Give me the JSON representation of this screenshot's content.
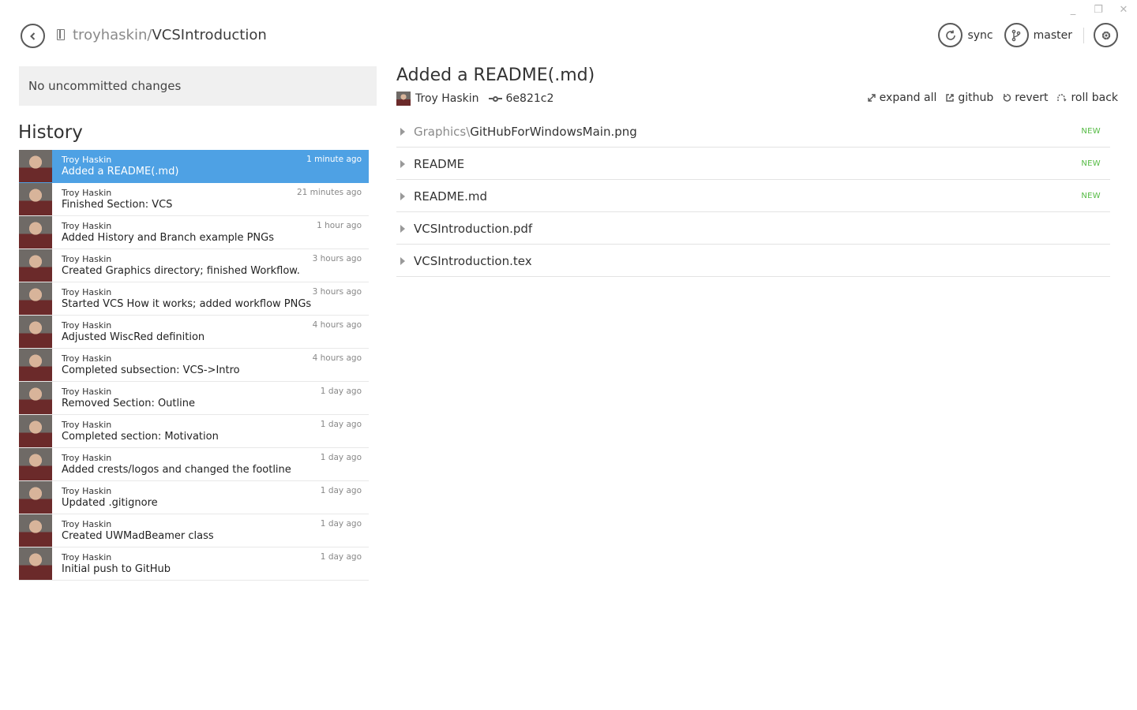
{
  "window_controls": {
    "minimize": "_",
    "restore": "❐",
    "close": "✕"
  },
  "header": {
    "repo_owner": "troyhaskin",
    "repo_separator": "/",
    "repo_name": "VCSIntroduction",
    "sync_label": "sync",
    "branch_label": "master"
  },
  "uncommitted": {
    "label": "No uncommitted changes"
  },
  "history": {
    "title": "History",
    "commits": [
      {
        "author": "Troy Haskin",
        "message": "Added a README(.md)",
        "time": "1 minute ago",
        "selected": true
      },
      {
        "author": "Troy Haskin",
        "message": "Finished Section: VCS",
        "time": "21 minutes ago"
      },
      {
        "author": "Troy Haskin",
        "message": "Added History and Branch example PNGs",
        "time": "1 hour ago"
      },
      {
        "author": "Troy Haskin",
        "message": "Created Graphics directory; finished Workflow.",
        "time": "3 hours ago"
      },
      {
        "author": "Troy Haskin",
        "message": "Started VCS How it works; added workflow PNGs",
        "time": "3 hours ago"
      },
      {
        "author": "Troy Haskin",
        "message": "Adjusted WiscRed definition",
        "time": "4 hours ago"
      },
      {
        "author": "Troy Haskin",
        "message": "Completed subsection: VCS->Intro",
        "time": "4 hours ago"
      },
      {
        "author": "Troy Haskin",
        "message": "Removed Section: Outline",
        "time": "1 day ago"
      },
      {
        "author": "Troy Haskin",
        "message": "Completed section: Motivation",
        "time": "1 day ago"
      },
      {
        "author": "Troy Haskin",
        "message": "Added crests/logos and changed the footline",
        "time": "1 day ago"
      },
      {
        "author": "Troy Haskin",
        "message": "Updated .gitignore",
        "time": "1 day ago"
      },
      {
        "author": "Troy Haskin",
        "message": "Created UWMadBeamer class",
        "time": "1 day ago"
      },
      {
        "author": "Troy Haskin",
        "message": "Initial push to GitHub",
        "time": "1 day ago"
      }
    ]
  },
  "commit_detail": {
    "title": "Added a README(.md)",
    "author": "Troy Haskin",
    "sha": "6e821c2",
    "actions": {
      "expand_all": "expand all",
      "github": "github",
      "revert": "revert",
      "roll_back": "roll back"
    },
    "files": [
      {
        "dir": "Graphics\\",
        "name": "GitHubForWindowsMain.png",
        "badge": "NEW"
      },
      {
        "dir": "",
        "name": "README",
        "badge": "NEW"
      },
      {
        "dir": "",
        "name": "README.md",
        "badge": "NEW"
      },
      {
        "dir": "",
        "name": "VCSIntroduction.pdf",
        "badge": ""
      },
      {
        "dir": "",
        "name": "VCSIntroduction.tex",
        "badge": ""
      }
    ]
  },
  "colors": {
    "selected": "#4ea1e4",
    "new_badge": "#55bb44",
    "panel": "#f0f0f0"
  }
}
